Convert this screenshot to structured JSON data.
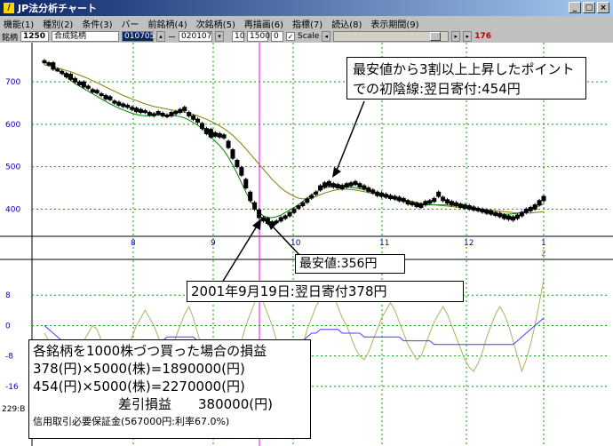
{
  "window": {
    "title": "JP法分析チャート",
    "icon": "chart-icon"
  },
  "menu": [
    "機能(1)",
    "種別(2)",
    "条件(3)",
    "バー",
    "前銘柄(4)",
    "次銘柄(5)",
    "再描画(6)",
    "指標(7)",
    "読込(8)",
    "表示期間(9)"
  ],
  "toolbar": {
    "label_code": "銘柄",
    "code": "1250",
    "name": "合成銘柄",
    "date_from": "010705",
    "sep": "ー",
    "date_to": "020107",
    "param1": "10",
    "param2": "1500",
    "param3": "0",
    "scale_label": "Scale",
    "badge": "176"
  },
  "chart_data": {
    "type": "line",
    "price_panel": {
      "y_ticks": [
        400,
        500,
        600,
        700
      ],
      "y_range": [
        340,
        780
      ],
      "x_ticks": [
        "8",
        "9",
        "10",
        "11",
        "12",
        "1"
      ],
      "x_extra": "2",
      "candles": [
        [
          750,
          745
        ],
        [
          745,
          740
        ],
        [
          745,
          730
        ],
        [
          730,
          728
        ],
        [
          725,
          720
        ],
        [
          720,
          712
        ],
        [
          718,
          706
        ],
        [
          708,
          700
        ],
        [
          700,
          693
        ],
        [
          700,
          688
        ],
        [
          690,
          685
        ],
        [
          682,
          676
        ],
        [
          680,
          674
        ],
        [
          672,
          668
        ],
        [
          668,
          660
        ],
        [
          665,
          658
        ],
        [
          655,
          650
        ],
        [
          652,
          645
        ],
        [
          648,
          642
        ],
        [
          645,
          640
        ],
        [
          640,
          635
        ],
        [
          638,
          630
        ],
        [
          635,
          628
        ],
        [
          632,
          628
        ],
        [
          628,
          622
        ],
        [
          625,
          620
        ],
        [
          630,
          624
        ],
        [
          626,
          620
        ],
        [
          622,
          618
        ],
        [
          628,
          620
        ],
        [
          630,
          625
        ],
        [
          635,
          628
        ],
        [
          640,
          632
        ],
        [
          628,
          620
        ],
        [
          620,
          612
        ],
        [
          612,
          605
        ],
        [
          602,
          590
        ],
        [
          590,
          578
        ],
        [
          588,
          570
        ],
        [
          580,
          572
        ],
        [
          578,
          570
        ],
        [
          575,
          568
        ],
        [
          560,
          545
        ],
        [
          540,
          520
        ],
        [
          515,
          500
        ],
        [
          498,
          480
        ],
        [
          470,
          450
        ],
        [
          440,
          420
        ],
        [
          415,
          400
        ],
        [
          398,
          380
        ],
        [
          380,
          372
        ],
        [
          378,
          366
        ],
        [
          370,
          362
        ],
        [
          372,
          368
        ],
        [
          380,
          372
        ],
        [
          384,
          378
        ],
        [
          392,
          384
        ],
        [
          400,
          392
        ],
        [
          408,
          402
        ],
        [
          415,
          408
        ],
        [
          424,
          416
        ],
        [
          432,
          426
        ],
        [
          440,
          435
        ],
        [
          455,
          445
        ],
        [
          462,
          452
        ],
        [
          465,
          455
        ],
        [
          460,
          452
        ],
        [
          458,
          450
        ],
        [
          456,
          448
        ],
        [
          460,
          452
        ],
        [
          462,
          455
        ],
        [
          465,
          458
        ],
        [
          460,
          452
        ],
        [
          455,
          448
        ],
        [
          450,
          442
        ],
        [
          445,
          438
        ],
        [
          440,
          432
        ],
        [
          438,
          430
        ],
        [
          435,
          428
        ],
        [
          432,
          425
        ],
        [
          430,
          424
        ],
        [
          428,
          420
        ],
        [
          425,
          418
        ],
        [
          420,
          412
        ],
        [
          416,
          410
        ],
        [
          414,
          406
        ],
        [
          412,
          404
        ],
        [
          418,
          410
        ],
        [
          420,
          414
        ],
        [
          425,
          418
        ],
        [
          440,
          430
        ],
        [
          428,
          420
        ],
        [
          422,
          414
        ],
        [
          418,
          410
        ],
        [
          415,
          408
        ],
        [
          412,
          404
        ],
        [
          410,
          402
        ],
        [
          408,
          400
        ],
        [
          405,
          398
        ],
        [
          402,
          396
        ],
        [
          400,
          393
        ],
        [
          398,
          390
        ],
        [
          396,
          388
        ],
        [
          392,
          385
        ],
        [
          390,
          382
        ],
        [
          386,
          378
        ],
        [
          384,
          376
        ],
        [
          382,
          374
        ],
        [
          386,
          378
        ],
        [
          392,
          384
        ],
        [
          400,
          392
        ],
        [
          404,
          396
        ],
        [
          410,
          400
        ],
        [
          420,
          410
        ],
        [
          430,
          420
        ]
      ],
      "ma_short": [
        748,
        742,
        735,
        728,
        720,
        712,
        704,
        696,
        690,
        684,
        678,
        672,
        666,
        660,
        654,
        648,
        643,
        638,
        634,
        630,
        626,
        623,
        621,
        620,
        620,
        621,
        622,
        622,
        622,
        621,
        620,
        618,
        615,
        610,
        604,
        598,
        590,
        580,
        570,
        560,
        550,
        538,
        522,
        504,
        484,
        462,
        440,
        420,
        404,
        392,
        384,
        380,
        380,
        382,
        386,
        392,
        398,
        404,
        410,
        418,
        426,
        434,
        440,
        446,
        450,
        452,
        452,
        452,
        452,
        452,
        451,
        450,
        448,
        446,
        443,
        440,
        436,
        432,
        429,
        426,
        423,
        420,
        418,
        416,
        414,
        412,
        411,
        410,
        410,
        410,
        410,
        410,
        410,
        409,
        408,
        407,
        405,
        403,
        401,
        399,
        397,
        395,
        393,
        391,
        389,
        388,
        388,
        389,
        390,
        393,
        396,
        400,
        404,
        408,
        412
      ],
      "ma_long": [
        740,
        738,
        736,
        733,
        730,
        727,
        724,
        720,
        716,
        712,
        708,
        703,
        698,
        693,
        688,
        683,
        678,
        673,
        668,
        664,
        660,
        656,
        652,
        648,
        645,
        642,
        640,
        638,
        636,
        634,
        632,
        630,
        628,
        626,
        623,
        620,
        616,
        612,
        607,
        602,
        596,
        590,
        582,
        574,
        564,
        554,
        542,
        530,
        518,
        506,
        494,
        482,
        470,
        460,
        450,
        442,
        436,
        430,
        426,
        424,
        424,
        426,
        430,
        434,
        438,
        441,
        444,
        446,
        447,
        447,
        446,
        445,
        443,
        441,
        439,
        437,
        435,
        432,
        430,
        428,
        426,
        424,
        422,
        420,
        418,
        416,
        414,
        412,
        411,
        410,
        409,
        408,
        407,
        406,
        405,
        404,
        403,
        402,
        401,
        400,
        399,
        398,
        397,
        396,
        395,
        394,
        393,
        392,
        391,
        391,
        391,
        391,
        392,
        393,
        394
      ]
    },
    "oscillator_panel": {
      "y_ticks": [
        8,
        0,
        -8,
        -16
      ],
      "y_range": [
        -20,
        16
      ],
      "blue": [
        0,
        -1,
        -2,
        -3,
        -4,
        -5,
        -5,
        -5,
        -5,
        -6,
        -6,
        -6,
        -6,
        -6,
        -5,
        -5,
        -5,
        -5,
        -5,
        -5,
        -4,
        -4,
        -4,
        -4,
        -4,
        -4,
        -4,
        -4,
        -3,
        -3,
        -3,
        -3,
        -3,
        -3,
        -3,
        -4,
        -4,
        -5,
        -6,
        -7,
        -8,
        -9,
        -10,
        -11,
        -12,
        -13,
        -14,
        -15,
        -15,
        -14,
        -13,
        -12,
        -11,
        -10,
        -9,
        -8,
        -7,
        -6,
        -5,
        -4,
        -3,
        -2,
        -2,
        -1,
        -1,
        -1,
        -1,
        -1,
        -2,
        -2,
        -2,
        -2,
        -2,
        -3,
        -3,
        -3,
        -3,
        -3,
        -3,
        -3,
        -3,
        -3,
        -4,
        -4,
        -4,
        -4,
        -4,
        -4,
        -4,
        -5,
        -5,
        -5,
        -5,
        -5,
        -5,
        -5,
        -5,
        -5,
        -5,
        -5,
        -5,
        -5,
        -5,
        -5,
        -5,
        -5,
        -5,
        -5,
        -4,
        -3,
        -2,
        -1,
        0,
        1,
        2
      ],
      "olive": [
        -2,
        -4,
        -6,
        -7,
        -9,
        -10,
        -11,
        -9,
        -7,
        -4,
        -2,
        0,
        -1,
        -4,
        -6,
        -8,
        -10,
        -12,
        -10,
        -7,
        -3,
        0,
        2,
        4,
        2,
        0,
        -3,
        -6,
        -8,
        -6,
        -3,
        0,
        3,
        5,
        2,
        -2,
        -6,
        -10,
        -14,
        -16,
        -18,
        -17,
        -15,
        -12,
        -8,
        -4,
        0,
        3,
        6,
        8,
        6,
        3,
        0,
        -4,
        -8,
        -12,
        -14,
        -12,
        -9,
        -5,
        -1,
        2,
        5,
        7,
        9,
        10,
        8,
        5,
        2,
        0,
        -3,
        -6,
        -8,
        -9,
        -7,
        -4,
        -1,
        2,
        4,
        6,
        4,
        1,
        -2,
        -5,
        -7,
        -9,
        -8,
        -5,
        -2,
        1,
        3,
        5,
        3,
        0,
        -3,
        -6,
        -9,
        -11,
        -12,
        -10,
        -7,
        -3,
        0,
        3,
        5,
        3,
        0,
        -4,
        -8,
        -12,
        -9,
        -5,
        0,
        6,
        12
      ]
    }
  },
  "annotations": {
    "point_note": [
      "最安値から3割以上上昇したポイント",
      "での初陰線:翌日寄付:454円"
    ],
    "low_note": "最安値:356円",
    "date_note": "2001年9月19日:翌日寄付378円",
    "calc_title": "各銘柄を1000株づつ買った場合の損益",
    "calc_line1": "378(円)×5000(株)=1890000(円)",
    "calc_line2": "454(円)×5000(株)=2270000(円)",
    "calc_line3": "差引損益　　380000(円)",
    "calc_note": "信用取引必要保証金(567000円:利率67.0%)"
  },
  "footer": "229:B",
  "colors": {
    "up": "#ff0000",
    "down": "#000000",
    "ma_short": "#008000",
    "ma_long": "#808000",
    "blue_line": "#4040ff",
    "olive_line": "#b0b060",
    "grid": "#00a000",
    "cursor": "#ff00ff",
    "axis_text": "#0000c0"
  }
}
